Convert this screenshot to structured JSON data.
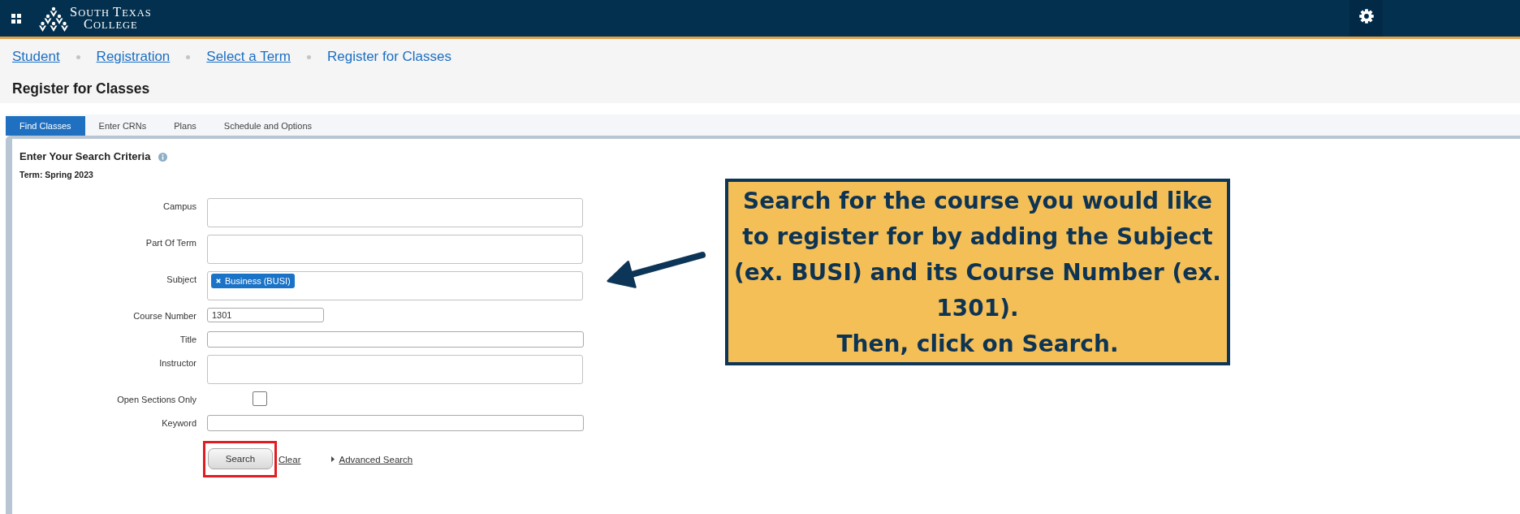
{
  "top_bar": {
    "logo": {
      "line_1": "SOUTH TEXAS",
      "line_2": "COLLEGE"
    }
  },
  "breadcrumbs": [
    {
      "label": "Student",
      "kind": "link"
    },
    {
      "label": "Registration",
      "kind": "link"
    },
    {
      "label": "Select a Term",
      "kind": "link"
    },
    {
      "label": "Register for Classes",
      "kind": "current"
    }
  ],
  "page_title": "Register for Classes",
  "tabs": [
    {
      "label": "Find Classes",
      "selected": true
    },
    {
      "label": "Enter CRNs",
      "selected": false
    },
    {
      "label": "Plans",
      "selected": false
    },
    {
      "label": "Schedule and Options",
      "selected": false
    }
  ],
  "search_panel": {
    "heading": "Enter Your Search Criteria",
    "term": "Term: Spring 2023",
    "fields": [
      {
        "label": "Campus",
        "kind": "multiselect"
      },
      {
        "label": "Part Of Term",
        "kind": "multiselect"
      },
      {
        "label": "Subject",
        "kind": "multiselect",
        "tags": [
          "Business (BUSI)"
        ]
      },
      {
        "label": "Course Number",
        "kind": "short_text",
        "value": "1301"
      },
      {
        "label": "Title",
        "kind": "text"
      },
      {
        "label": "Instructor",
        "kind": "multiselect"
      },
      {
        "label": "Open Sections Only",
        "kind": "checkbox",
        "checked": false
      },
      {
        "label": "Keyword",
        "kind": "text"
      }
    ],
    "actions": {
      "search": {
        "label": "Search",
        "highlighted": true
      },
      "clear": "Clear",
      "advanced_search": "Advanced Search"
    }
  },
  "callout": {
    "text": "Search for the course you would like to register for by adding the Subject (ex. BUSI) and its Course Number (ex. 1301).\nThen, click on Search."
  }
}
